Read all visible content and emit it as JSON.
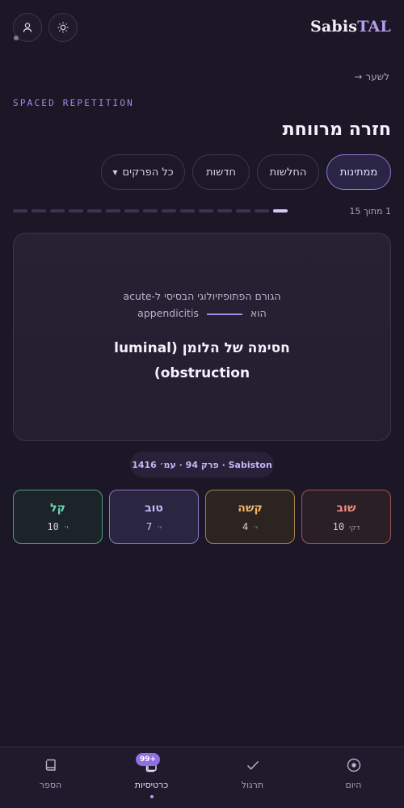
{
  "header": {
    "logo_part1": "Sabis",
    "logo_part2": "TAL",
    "user_icon": "user-icon",
    "theme_icon": "sun-icon"
  },
  "nav": {
    "back_label": "לשער",
    "back_arrow": "→"
  },
  "eyebrow": "SPACED REPETITION",
  "title": "חזרה מרווחת",
  "tabs": [
    {
      "label": "ממתינות",
      "active": true
    },
    {
      "label": "החלשות",
      "active": false
    },
    {
      "label": "חדשות",
      "active": false
    },
    {
      "label": "כל הפרקים",
      "active": false,
      "dropdown": true
    }
  ],
  "progress": {
    "current": 1,
    "total": 15,
    "text": "1 מתוך 15"
  },
  "card": {
    "question_line1": "הגורם הפתופיזיולוגי הבסיסי ל-acute",
    "question_line2_pre": "appendicitis",
    "question_line2_post": "הוא",
    "answer_line1": "חסימה של הלומן (luminal",
    "answer_line2": "obstruction)"
  },
  "source": "Sabiston · פרק 94 · עמ׳ 1416",
  "ratings": [
    {
      "key": "again",
      "label": "שוב",
      "value": "10",
      "unit": "דקי"
    },
    {
      "key": "hard",
      "label": "קשה",
      "value": "4",
      "unit": "י׳"
    },
    {
      "key": "good",
      "label": "טוב",
      "value": "7",
      "unit": "י׳"
    },
    {
      "key": "easy",
      "label": "קל",
      "value": "10",
      "unit": "י׳"
    }
  ],
  "bottom_nav": [
    {
      "label": "היום",
      "icon": "target-icon"
    },
    {
      "label": "תרגול",
      "icon": "check-icon"
    },
    {
      "label": "כרטיסיות",
      "icon": "cards-icon",
      "badge": "99+",
      "active": true
    },
    {
      "label": "הספר",
      "icon": "book-icon"
    }
  ],
  "colors": {
    "background": "#1b1727",
    "accent": "#b69cf0",
    "again": "#f08c82",
    "hard": "#f0b36c",
    "good": "#c9b8f7",
    "easy": "#6ed5b3"
  }
}
